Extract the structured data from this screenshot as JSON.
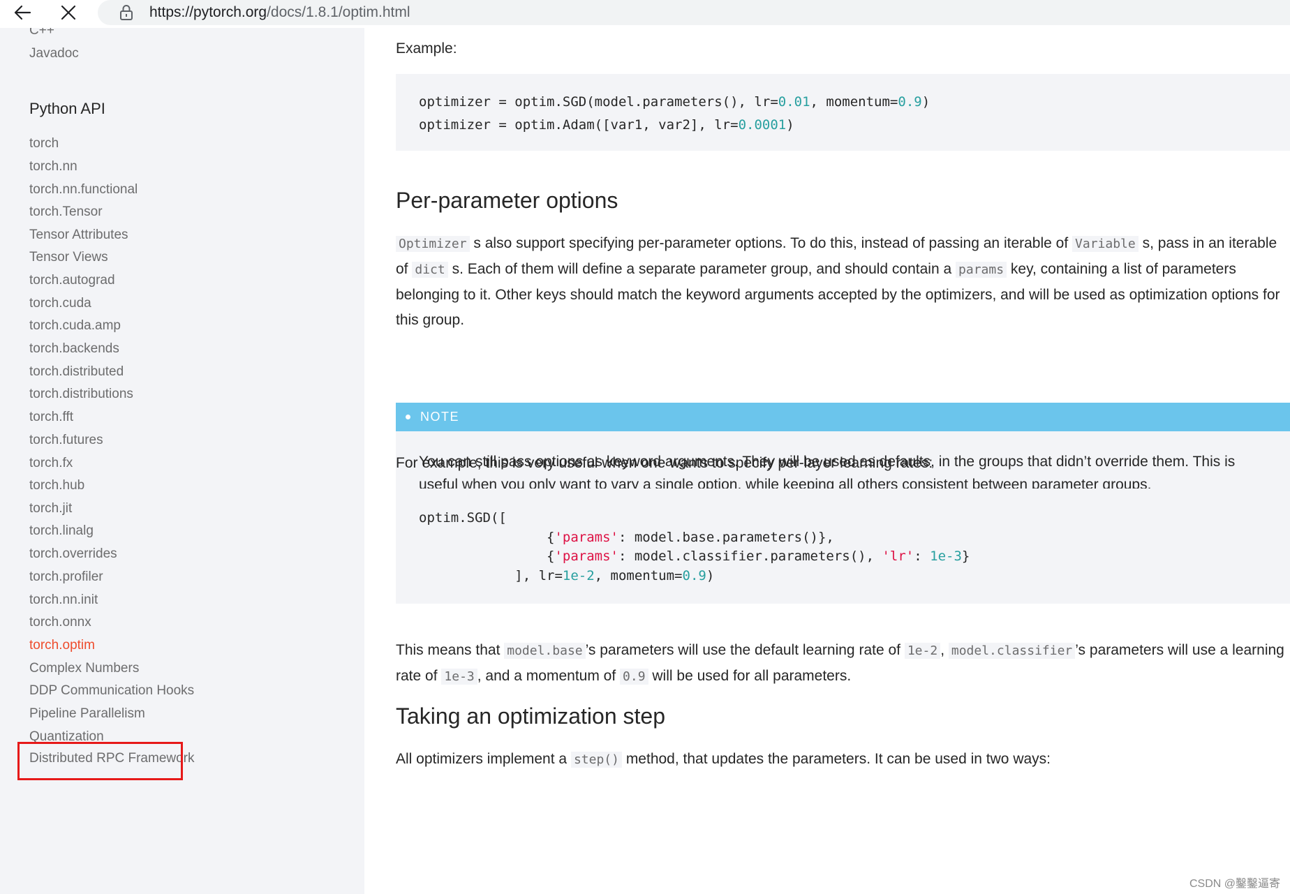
{
  "browser": {
    "url_host": "https://pytorch.org",
    "url_path": "/docs/1.8.1/optim.html",
    "back_icon": "arrow-left-icon",
    "close_icon": "close-icon",
    "lock_icon": "lock-icon"
  },
  "sidebar": {
    "top_items": [
      "C++",
      "Javadoc"
    ],
    "section_title": "Python API",
    "items": [
      "torch",
      "torch.nn",
      "torch.nn.functional",
      "torch.Tensor",
      "Tensor Attributes",
      "Tensor Views",
      "torch.autograd",
      "torch.cuda",
      "torch.cuda.amp",
      "torch.backends",
      "torch.distributed",
      "torch.distributions",
      "torch.fft",
      "torch.futures",
      "torch.fx",
      "torch.hub",
      "torch.jit",
      "torch.linalg",
      "torch.overrides",
      "torch.profiler",
      "torch.nn.init",
      "torch.onnx",
      "torch.optim",
      "Complex Numbers",
      "DDP Communication Hooks",
      "Pipeline Parallelism",
      "Quantization",
      "Distributed RPC Framework"
    ],
    "active_item": "torch.optim",
    "active_color": "#ee4c2c",
    "highlight_color": "#e61919"
  },
  "content": {
    "example_label": "Example:",
    "code1": {
      "line1": {
        "a": "optimizer = optim.SGD(model.parameters(), lr=",
        "n1": "0.01",
        "b": ", momentum=",
        "n2": "0.9",
        "c": ")"
      },
      "line2": {
        "a": "optimizer = optim.Adam([var1, var2], lr=",
        "n1": "0.0001",
        "b": ")"
      }
    },
    "heading_per_param": "Per-parameter options",
    "para1": {
      "c1": "Optimizer",
      "t1": "s also support specifying per-parameter options. To do this, instead of passing an iterable of",
      "c2": "Variable",
      "t2": "s, pass in an iterable of",
      "c3": "dict",
      "t3": "s. Each of them will define a separate parameter group, and should contain a",
      "c4": "params",
      "t4": "key, containing a list of parameters belonging to it. Other keys should match the keyword arguments accepted by the optimizers, and will be used as optimization options for this group."
    },
    "note": {
      "title": "NOTE",
      "body": "You can still pass options as keyword arguments. They will be used as defaults, in the groups that didn’t override them. This is useful when you only want to vary a single option, while keeping all others consistent between parameter groups.",
      "header_color": "#6bc5ec"
    },
    "para2": "For example, this is very useful when one wants to specify per-layer learning rates:",
    "code2": {
      "l1": "optim.SGD([",
      "l2": {
        "a": "                {",
        "s1": "'params'",
        "b": ": model.base.parameters()},"
      },
      "l3": {
        "a": "                {",
        "s1": "'params'",
        "b": ": model.classifier.parameters(), ",
        "s2": "'lr'",
        "c": ": ",
        "n1": "1e-3",
        "d": "}"
      },
      "l4": {
        "a": "            ], lr=",
        "n1": "1e-2",
        "b": ", momentum=",
        "n2": "0.9",
        "c": ")"
      }
    },
    "para3": {
      "t1": "This means that",
      "c1": "model.base",
      "t2": "’s parameters will use the default learning rate of",
      "c2": "1e-2",
      "t3": ",",
      "c3": "model.classifier",
      "t4": "’s parameters will use a learning rate of",
      "c4": "1e-3",
      "t5": ", and a momentum of",
      "c5": "0.9",
      "t6": "will be used for all parameters."
    },
    "heading_step": "Taking an optimization step",
    "para4": {
      "t1": "All optimizers implement a",
      "c1": "step()",
      "t2": "method, that updates the parameters. It can be used in two ways:"
    }
  },
  "watermark": "CSDN @鑿鑿逼寄"
}
